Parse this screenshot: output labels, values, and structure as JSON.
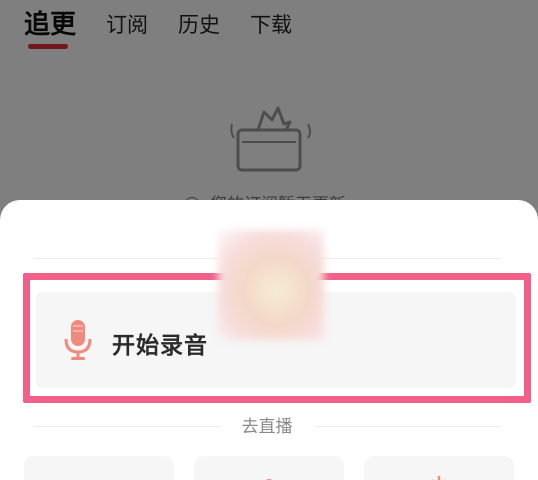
{
  "header": {
    "tabs": [
      {
        "label": "追更",
        "active": true
      },
      {
        "label": "订阅",
        "active": false
      },
      {
        "label": "历史",
        "active": false
      },
      {
        "label": "下载",
        "active": false
      }
    ]
  },
  "empty_state": {
    "message": "您的订阅暂无更新"
  },
  "sheet": {
    "record_button_label": "开始录音",
    "live_section_label": "去直播"
  },
  "colors": {
    "accent": "#e0313a",
    "highlight": "#f2608a",
    "mic": "#f08a7c"
  }
}
